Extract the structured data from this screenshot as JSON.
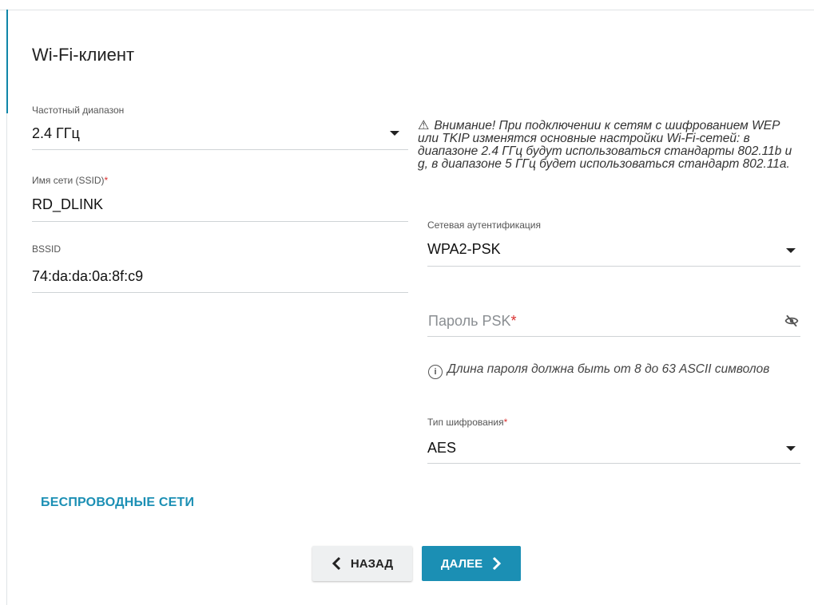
{
  "title": "Wi-Fi-клиент",
  "left": {
    "band": {
      "label": "Частотный диапазон",
      "value": "2.4 ГГц"
    },
    "ssid": {
      "label": "Имя сети (SSID)",
      "required": "*",
      "value": "RD_DLINK"
    },
    "bssid": {
      "label": "BSSID",
      "value": "74:da:da:0a:8f:c9"
    }
  },
  "warning": {
    "icon": "⚠",
    "text": "Внимание! При подключении к сетям с шифрованием WEP или TKIP изменятся основные настройки Wi-Fi-сетей: в диапазоне 2.4 ГГц будут использоваться стандарты 802.11b и g, в диапазоне 5 ГГц будет использоваться стандарт 802.11a."
  },
  "auth": {
    "label": "Сетевая аутентификация",
    "value": "WPA2-PSK"
  },
  "password": {
    "placeholder": "Пароль PSK",
    "required": "*"
  },
  "hint": {
    "icon": "i",
    "text": "Длина пароля должна быть от 8 до 63 ASCII символов"
  },
  "cipher": {
    "label": "Тип шифрования",
    "required": "*",
    "value": "AES"
  },
  "wireless_link": "БЕСПРОВОДНЫЕ СЕТИ",
  "buttons": {
    "back": "НАЗАД",
    "next": "ДАЛЕЕ"
  },
  "icons": {
    "back": "chevron-left-icon",
    "next": "chevron-right-icon",
    "eye": "eye-off-icon",
    "warning": "warning-icon",
    "info": "info-icon"
  },
  "colors": {
    "accent": "#1b8fb4",
    "required": "#d9302f"
  }
}
